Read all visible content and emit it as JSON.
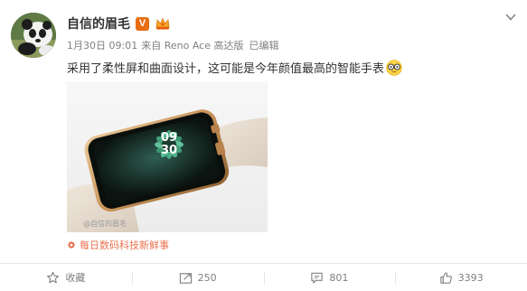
{
  "post": {
    "author": {
      "name": "自信的眉毛",
      "verified_badge": "V"
    },
    "meta": {
      "date": "1月30日 09:01",
      "source": "来自 Reno Ace 高达版",
      "edited": "已编辑"
    },
    "text": "采用了柔性屏和曲面设计，这可能是今年颜值最高的智能手表",
    "image": {
      "watermark": "@自信的眉毛",
      "watch_hour": "09",
      "watch_minute": "30"
    },
    "topic": "每日数码科技新鲜事"
  },
  "actions": {
    "favorite_label": "收藏",
    "repost_count": "250",
    "comment_count": "801",
    "like_count": "3393"
  },
  "colors": {
    "text": "#333333",
    "meta": "#808080",
    "verified": "#e86d13",
    "topic": "#eb7350",
    "divider": "#e6e6e6"
  },
  "icons": {
    "chevron": "chevron-down-icon",
    "topic": "flower-icon",
    "favorite": "star-icon",
    "repost": "repost-icon",
    "comment": "comment-icon",
    "like": "thumbs-up-icon"
  }
}
